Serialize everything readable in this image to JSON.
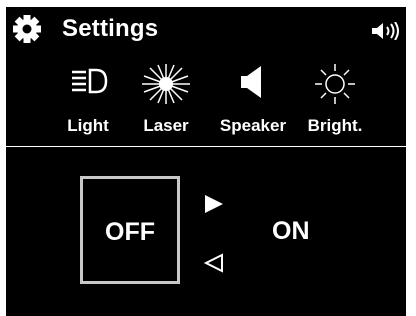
{
  "header": {
    "title": "Settings",
    "gear_icon": "gear-icon",
    "volume_icon": "speaker-volume-icon"
  },
  "toolbar": {
    "items": [
      {
        "label": "Light",
        "icon": "headlight-icon"
      },
      {
        "label": "Laser",
        "icon": "laser-burst-icon"
      },
      {
        "label": "Speaker",
        "icon": "speaker-icon"
      },
      {
        "label": "Bright.",
        "icon": "sun-brightness-icon"
      }
    ]
  },
  "toggle": {
    "off_label": "OFF",
    "on_label": "ON",
    "selected": "OFF"
  },
  "colors": {
    "background": "#000000",
    "foreground": "#ffffff",
    "frame": "#c8c8c8"
  }
}
